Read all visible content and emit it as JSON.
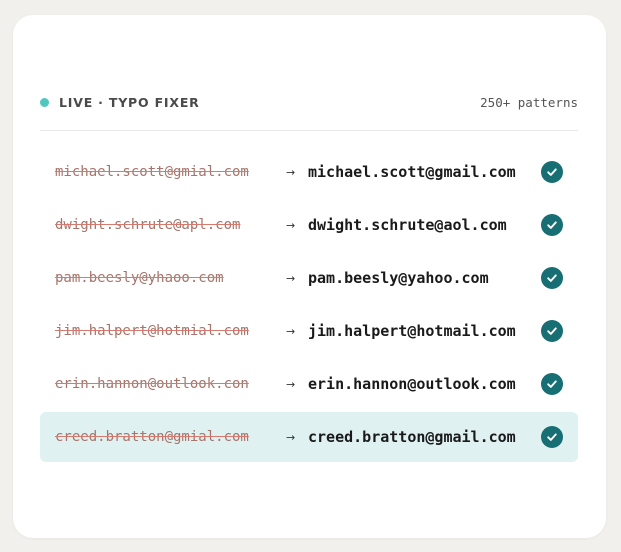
{
  "header": {
    "live_label": "LIVE · TYPO FIXER",
    "patterns_label": "250+ patterns"
  },
  "colors": {
    "live_dot": "#4fc6be",
    "check_bg": "#176e73",
    "highlight_bg": "#e0f1f2",
    "strike": "#d57a6e"
  },
  "rows": [
    {
      "typo": "michael.scott@gmial.com",
      "arrow": "→",
      "fixed": "michael.scott@gmail.com",
      "icon": "check-circle-icon",
      "highlighted": false
    },
    {
      "typo": "dwight.schrute@apl.com",
      "arrow": "→",
      "fixed": "dwight.schrute@aol.com",
      "icon": "check-circle-icon",
      "highlighted": false
    },
    {
      "typo": "pam.beesly@yhaoo.com",
      "arrow": "→",
      "fixed": "pam.beesly@yahoo.com",
      "icon": "check-circle-icon",
      "highlighted": false
    },
    {
      "typo": "jim.halpert@hotmial.com",
      "arrow": "→",
      "fixed": "jim.halpert@hotmail.com",
      "icon": "check-circle-icon",
      "highlighted": false
    },
    {
      "typo": "erin.hannon@outlook.con",
      "arrow": "→",
      "fixed": "erin.hannon@outlook.com",
      "icon": "check-circle-icon",
      "highlighted": false
    },
    {
      "typo": "creed.bratton@gmial.com",
      "arrow": "→",
      "fixed": "creed.bratton@gmail.com",
      "icon": "check-circle-icon",
      "highlighted": true
    }
  ]
}
